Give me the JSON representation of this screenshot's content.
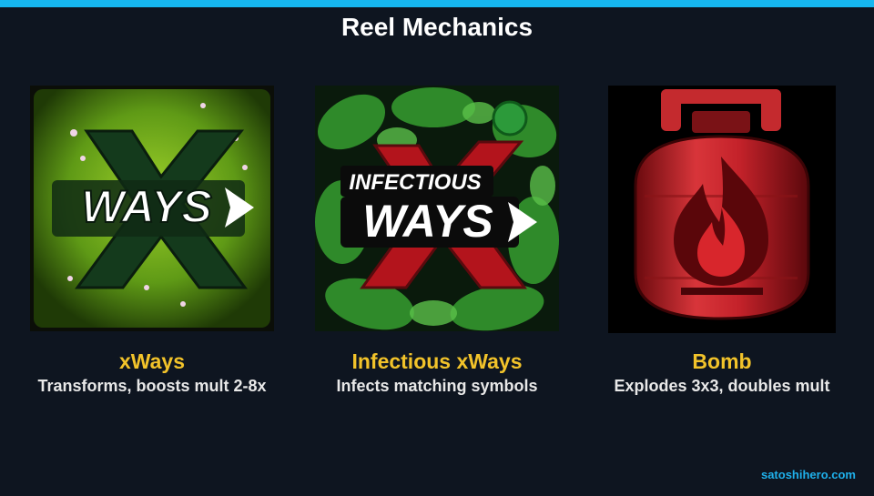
{
  "header": {
    "title": "Reel Mechanics"
  },
  "cards": [
    {
      "name": "xWays",
      "description": "Transforms, boosts mult 2-8x",
      "art_text": "WAYS",
      "icon": "xways-icon"
    },
    {
      "name": "Infectious xWays",
      "description": "Infects matching symbols",
      "art_text_top": "INFECTIOUS",
      "art_text": "WAYS",
      "icon": "infectious-xways-icon"
    },
    {
      "name": "Bomb",
      "description": "Explodes 3x3, doubles mult",
      "icon": "gas-canister-bomb-icon"
    }
  ],
  "footer": {
    "site": "satoshihero.com"
  },
  "colors": {
    "accent": "#16b7f0",
    "name_color": "#f2c32a",
    "background": "#0e1520"
  }
}
